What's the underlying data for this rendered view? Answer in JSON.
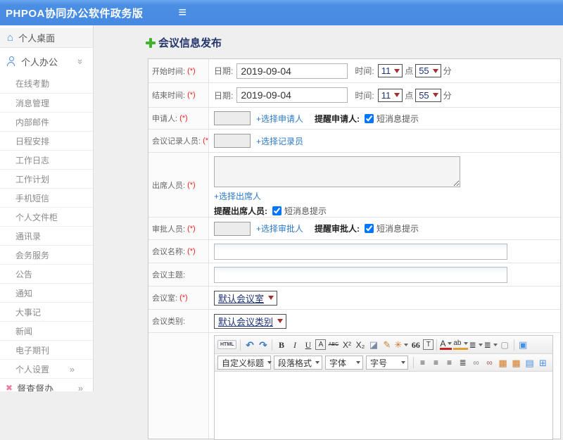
{
  "header": {
    "app_title": "PHPOA协同办公软件政务版"
  },
  "icons": {
    "menu": "≡",
    "home": "⌂",
    "supervise": "✖",
    "chevron": "»"
  },
  "sidebar": {
    "desktop": "个人桌面",
    "office": "个人办公",
    "items": [
      "在线考勤",
      "消息管理",
      "内部邮件",
      "日程安排",
      "工作日志",
      "工作计划",
      "手机短信",
      "个人文件柜",
      "通讯录",
      "会务服务",
      "公告",
      "通知",
      "大事记",
      "新闻",
      "电子期刊",
      "个人设置"
    ],
    "supervise": "督查督办"
  },
  "form": {
    "title": "会议信息发布",
    "required_mark": "(*)",
    "date_label": "日期:",
    "time_label": "时间:",
    "hour_suffix": "点",
    "minute_suffix": "分",
    "start": {
      "label": "开始时间:",
      "date": "2019-09-04",
      "hour": "11",
      "minute": "55"
    },
    "end": {
      "label": "结束时间:",
      "date": "2019-09-04",
      "hour": "11",
      "minute": "55"
    },
    "applicant": {
      "label": "申请人:",
      "link": "+选择申请人",
      "remind_label": "提醒申请人:",
      "sms": "短消息提示"
    },
    "recorder": {
      "label": "会议记录人员:",
      "link": "+选择记录员"
    },
    "attendees": {
      "label": "出席人员:",
      "link": "+选择出席人",
      "remind_label": "提醒出席人员:",
      "sms": "短消息提示"
    },
    "approver": {
      "label": "审批人员:",
      "link": "+选择审批人",
      "remind_label": "提醒审批人:",
      "sms": "短消息提示"
    },
    "meeting_name": {
      "label": "会议名称:"
    },
    "meeting_subject": {
      "label": "会议主题:"
    },
    "meeting_room": {
      "label": "会议室:",
      "value": "默认会议室"
    },
    "meeting_category": {
      "label": "会议类别:",
      "value": "默认会议类别"
    }
  },
  "editor": {
    "row1": [
      {
        "name": "html-source-button",
        "glyph": "HTML"
      },
      {
        "name": "undo-icon",
        "glyph": "↶"
      },
      {
        "name": "redo-icon",
        "glyph": "↷"
      },
      {
        "name": "bold-icon",
        "glyph": "B"
      },
      {
        "name": "italic-icon",
        "glyph": "I"
      },
      {
        "name": "underline-icon",
        "glyph": "U"
      },
      {
        "name": "font-frame-icon",
        "glyph": "A"
      },
      {
        "name": "strikethrough-icon",
        "glyph": "ABC"
      },
      {
        "name": "superscript-icon",
        "glyph": "X²"
      },
      {
        "name": "subscript-icon",
        "glyph": "X₂"
      },
      {
        "name": "eraser-icon",
        "glyph": "◪"
      },
      {
        "name": "brush-icon",
        "glyph": "✎"
      },
      {
        "name": "format-wand-icon",
        "glyph": "✳"
      },
      {
        "name": "blockquote-icon",
        "glyph": "66"
      },
      {
        "name": "paste-icon",
        "glyph": "T"
      },
      {
        "name": "font-color-icon",
        "glyph": "A"
      },
      {
        "name": "highlight-color-icon",
        "glyph": "ab"
      },
      {
        "name": "ordered-list-icon",
        "glyph": "≣"
      },
      {
        "name": "unordered-list-icon",
        "glyph": "≣"
      },
      {
        "name": "new-page-icon",
        "glyph": "▢"
      },
      {
        "name": "fullscreen-icon",
        "glyph": "▣"
      }
    ],
    "row2_selects": [
      "自定义标题",
      "段落格式",
      "字体",
      "字号"
    ],
    "row2_icons": [
      {
        "name": "align-left-icon",
        "glyph": "≡"
      },
      {
        "name": "align-center-icon",
        "glyph": "≡"
      },
      {
        "name": "align-right-icon",
        "glyph": "≡"
      },
      {
        "name": "align-justify-icon",
        "glyph": "≣"
      },
      {
        "name": "link-icon",
        "glyph": "∞"
      },
      {
        "name": "unlink-icon",
        "glyph": "∞"
      },
      {
        "name": "image-icon",
        "glyph": "▦"
      },
      {
        "name": "insert-image-icon",
        "glyph": "▦"
      },
      {
        "name": "page-layout-icon",
        "glyph": "▤"
      },
      {
        "name": "table-icon",
        "glyph": "⊞"
      }
    ]
  }
}
